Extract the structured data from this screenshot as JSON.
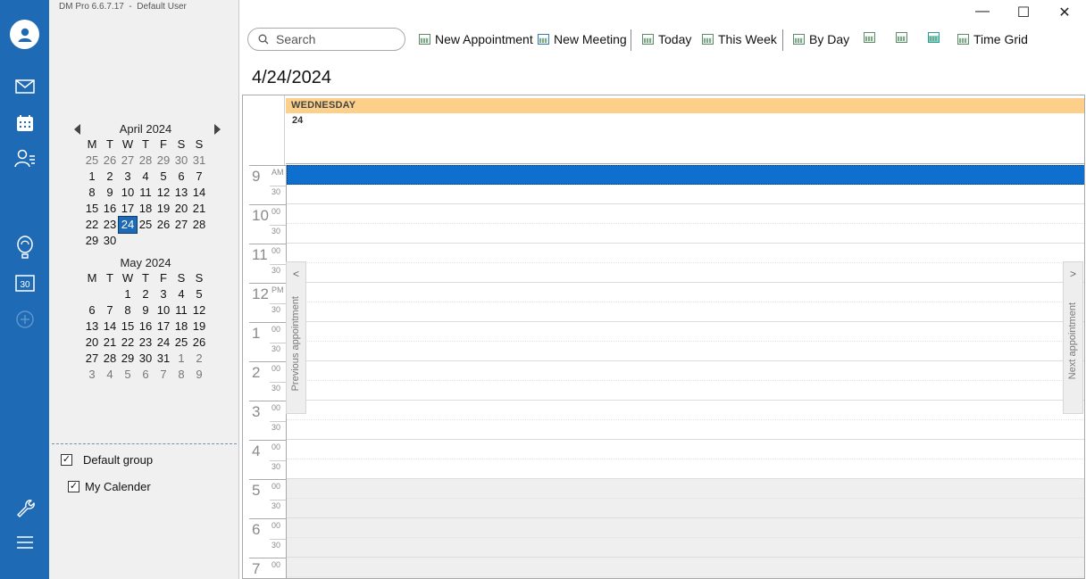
{
  "app": {
    "title": "DM Pro 6.6.7.17  -  Default User"
  },
  "window": {
    "minimize": "—",
    "maximize": "☐",
    "close": "✕"
  },
  "rail": {
    "icons": [
      "user-avatar-icon",
      "mail-icon",
      "calendar-icon",
      "contacts-icon",
      "balloon-icon",
      "day-30-icon",
      "add-icon",
      "wrench-icon",
      "menu-icon"
    ],
    "accent": "#1f6ab5"
  },
  "minical": {
    "dow": [
      "M",
      "T",
      "W",
      "T",
      "F",
      "S",
      "S"
    ],
    "april": {
      "title": "April 2024",
      "weeks": [
        [
          [
            "25",
            "other"
          ],
          [
            "26",
            "other"
          ],
          [
            "27",
            "other"
          ],
          [
            "28",
            "other"
          ],
          [
            "29",
            "other"
          ],
          [
            "30",
            "other"
          ],
          [
            "31",
            "other"
          ]
        ],
        [
          [
            "1",
            ""
          ],
          [
            "2",
            ""
          ],
          [
            "3",
            ""
          ],
          [
            "4",
            ""
          ],
          [
            "5",
            ""
          ],
          [
            "6",
            ""
          ],
          [
            "7",
            ""
          ]
        ],
        [
          [
            "8",
            ""
          ],
          [
            "9",
            ""
          ],
          [
            "10",
            ""
          ],
          [
            "11",
            ""
          ],
          [
            "12",
            ""
          ],
          [
            "13",
            ""
          ],
          [
            "14",
            ""
          ]
        ],
        [
          [
            "15",
            ""
          ],
          [
            "16",
            ""
          ],
          [
            "17",
            ""
          ],
          [
            "18",
            ""
          ],
          [
            "19",
            ""
          ],
          [
            "20",
            ""
          ],
          [
            "21",
            ""
          ]
        ],
        [
          [
            "22",
            ""
          ],
          [
            "23",
            ""
          ],
          [
            "24",
            "today"
          ],
          [
            "25",
            ""
          ],
          [
            "26",
            ""
          ],
          [
            "27",
            ""
          ],
          [
            "28",
            ""
          ]
        ],
        [
          [
            "29",
            ""
          ],
          [
            "30",
            ""
          ],
          [
            "",
            ""
          ],
          [
            "",
            ""
          ],
          [
            "",
            ""
          ],
          [
            "",
            ""
          ],
          [
            "",
            ""
          ]
        ]
      ]
    },
    "may": {
      "title": "May 2024",
      "weeks": [
        [
          [
            "",
            ""
          ],
          [
            "",
            ""
          ],
          [
            "1",
            ""
          ],
          [
            "2",
            ""
          ],
          [
            "3",
            ""
          ],
          [
            "4",
            ""
          ],
          [
            "5",
            ""
          ]
        ],
        [
          [
            "6",
            ""
          ],
          [
            "7",
            ""
          ],
          [
            "8",
            ""
          ],
          [
            "9",
            ""
          ],
          [
            "10",
            ""
          ],
          [
            "11",
            ""
          ],
          [
            "12",
            ""
          ]
        ],
        [
          [
            "13",
            ""
          ],
          [
            "14",
            ""
          ],
          [
            "15",
            ""
          ],
          [
            "16",
            ""
          ],
          [
            "17",
            ""
          ],
          [
            "18",
            ""
          ],
          [
            "19",
            ""
          ]
        ],
        [
          [
            "20",
            ""
          ],
          [
            "21",
            ""
          ],
          [
            "22",
            ""
          ],
          [
            "23",
            ""
          ],
          [
            "24",
            ""
          ],
          [
            "25",
            ""
          ],
          [
            "26",
            ""
          ]
        ],
        [
          [
            "27",
            ""
          ],
          [
            "28",
            ""
          ],
          [
            "29",
            ""
          ],
          [
            "30",
            ""
          ],
          [
            "31",
            ""
          ],
          [
            "1",
            "other"
          ],
          [
            "2",
            "other"
          ]
        ],
        [
          [
            "3",
            "other"
          ],
          [
            "4",
            "other"
          ],
          [
            "5",
            "other"
          ],
          [
            "6",
            "other"
          ],
          [
            "7",
            "other"
          ],
          [
            "8",
            "other"
          ],
          [
            "9",
            "other"
          ]
        ]
      ]
    }
  },
  "groups": {
    "default_group": {
      "label": "Default group",
      "checked": true
    },
    "my_calendar": {
      "label": "My Calender",
      "checked": true
    }
  },
  "toolbar": {
    "search_placeholder": "Search",
    "new_appointment": "New Appointment",
    "new_meeting": "New Meeting",
    "today": "Today",
    "this_week": "This Week",
    "by_day": "By Day",
    "time_grid": "Time Grid"
  },
  "view": {
    "date_title": "4/24/2024",
    "day_header": "WEDNESDAY",
    "day_number": "24",
    "hours": [
      {
        "n": "9",
        "s": "AM"
      },
      {
        "n": "10",
        "s": "00"
      },
      {
        "n": "11",
        "s": "00"
      },
      {
        "n": "12",
        "s": "PM"
      },
      {
        "n": "1",
        "s": "00"
      },
      {
        "n": "2",
        "s": "00"
      },
      {
        "n": "3",
        "s": "00"
      },
      {
        "n": "4",
        "s": "00"
      },
      {
        "n": "5",
        "s": "00"
      },
      {
        "n": "6",
        "s": "00"
      },
      {
        "n": "7",
        "s": "00"
      }
    ],
    "half_label": "30",
    "previous_appointment": "Previous appointment",
    "next_appointment": "Next appointment",
    "header_color": "#fcd08a",
    "selection_color": "#0f6fcf"
  }
}
